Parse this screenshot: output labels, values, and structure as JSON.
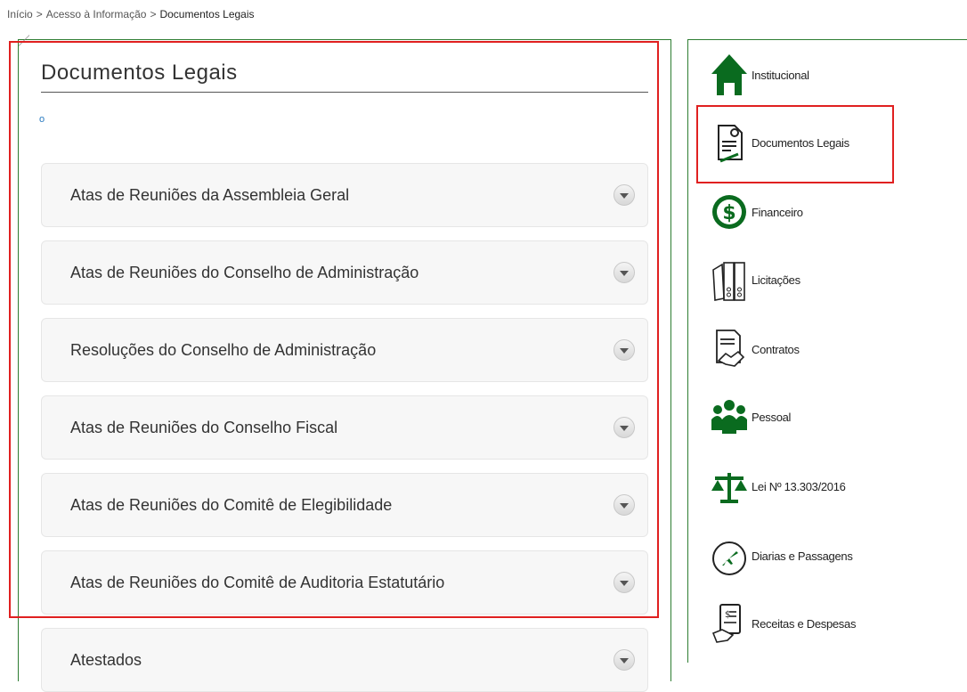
{
  "breadcrumb": {
    "home": "Início",
    "access": "Acesso à Informação",
    "current": "Documentos Legais",
    "separator": ">"
  },
  "page": {
    "title": "Documentos Legais",
    "marker": "o"
  },
  "accordion": [
    {
      "label": "Atas de Reuniões da Assembleia Geral"
    },
    {
      "label": "Atas de Reuniões do Conselho de Administração"
    },
    {
      "label": "Resoluções do Conselho de Administração"
    },
    {
      "label": "Atas de Reuniões do Conselho Fiscal"
    },
    {
      "label": "Atas de Reuniões do Comitê de Elegibilidade"
    },
    {
      "label": "Atas de Reuniões do Comitê de Auditoria Estatutário"
    },
    {
      "label": "Atestados"
    }
  ],
  "sidebar": {
    "items": [
      {
        "label": "Institucional",
        "icon": "house-icon"
      },
      {
        "label": "Documentos Legais",
        "icon": "legal-document-icon"
      },
      {
        "label": "Financeiro",
        "icon": "dollar-icon"
      },
      {
        "label": "Licitações",
        "icon": "binders-icon"
      },
      {
        "label": "Contratos",
        "icon": "contract-handshake-icon"
      },
      {
        "label": "Pessoal",
        "icon": "people-icon"
      },
      {
        "label": "Lei Nº 13.303/2016",
        "icon": "scales-icon"
      },
      {
        "label": "Diarias e Passagens",
        "icon": "airplane-icon"
      },
      {
        "label": "Receitas e Despesas",
        "icon": "receipt-hand-icon"
      }
    ]
  },
  "colors": {
    "accent_green": "#0a6b1f",
    "highlight_red": "#e02020"
  }
}
